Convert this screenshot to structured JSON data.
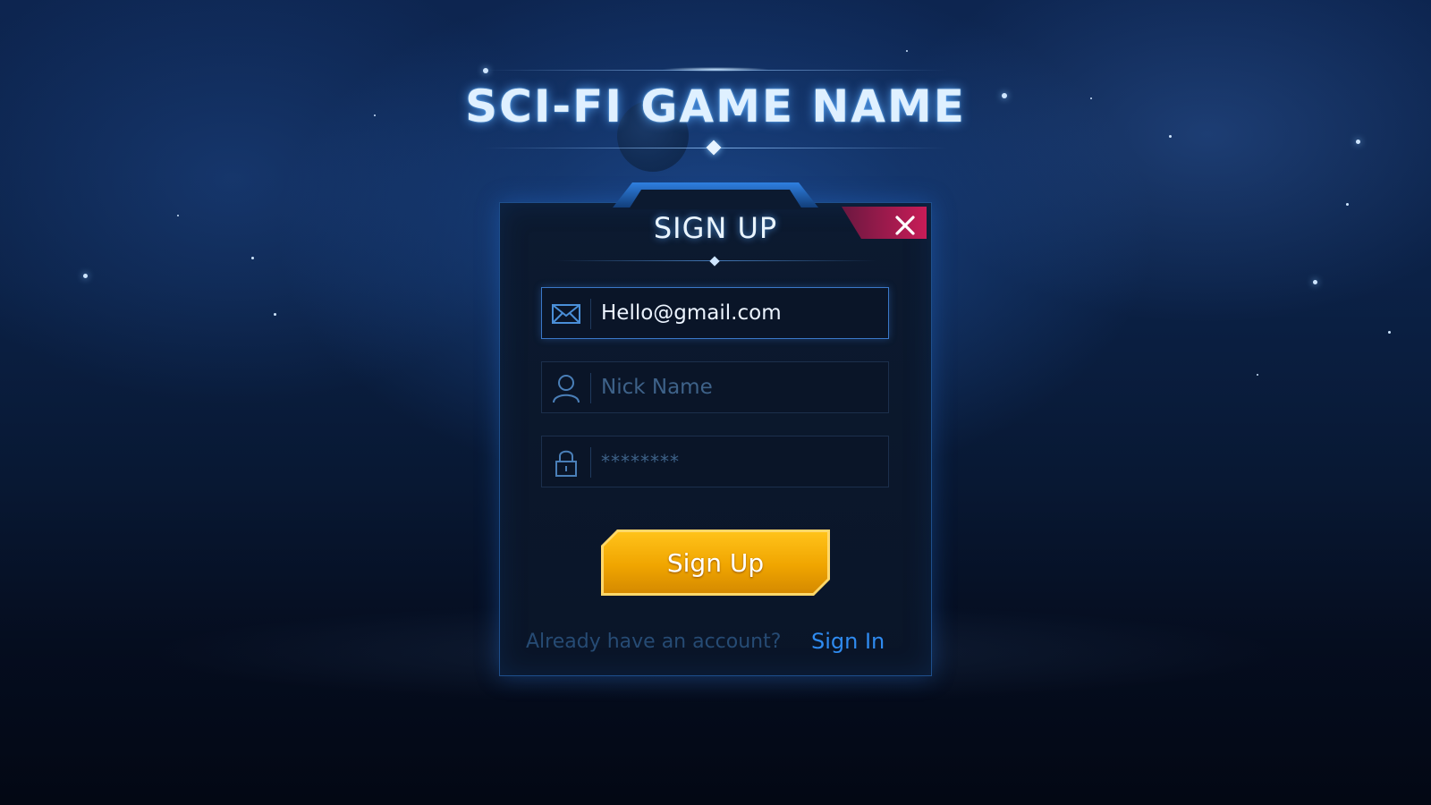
{
  "game": {
    "title": "SCI-FI GAME NAME"
  },
  "dialog": {
    "title": "SIGN UP",
    "close_icon": "close-icon"
  },
  "form": {
    "email": {
      "icon": "mail-icon",
      "value": "Hello@gmail.com",
      "placeholder": ""
    },
    "nickname": {
      "icon": "user-icon",
      "value": "",
      "placeholder": "Nick Name"
    },
    "password": {
      "icon": "lock-icon",
      "value": "",
      "placeholder": "********"
    },
    "submit_label": "Sign Up"
  },
  "footer": {
    "prompt": "Already have an account?",
    "link_label": "Sign In"
  },
  "colors": {
    "accent_blue": "#2f8bf0",
    "button_gold": "#f0a500",
    "close_red": "#c81c57",
    "background": "#0b2146"
  }
}
